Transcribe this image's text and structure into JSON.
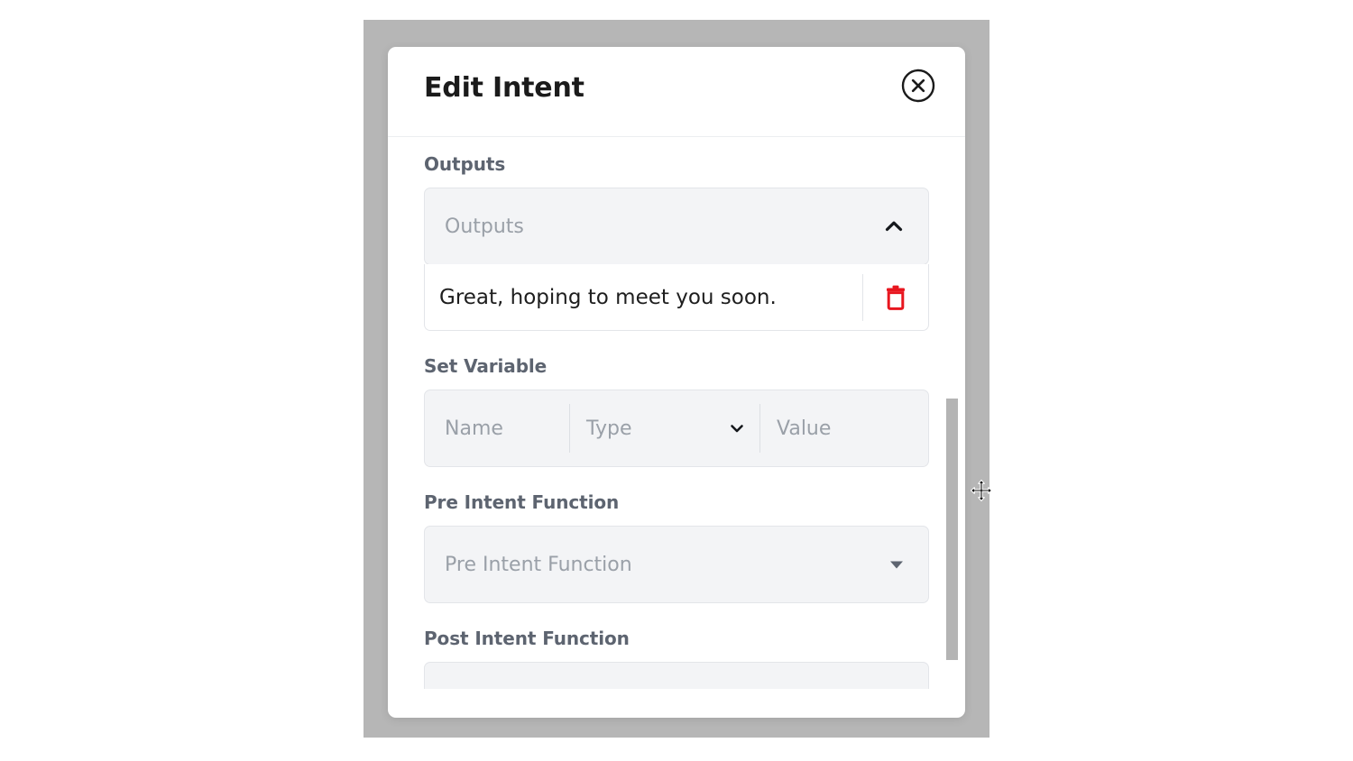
{
  "modal": {
    "title": "Edit Intent",
    "close_icon": "close-circle-icon",
    "sections": [
      {
        "label": "Outputs",
        "field_placeholder": "Outputs",
        "caret_icon": "chevron-up-icon",
        "rows": [
          {
            "text": "Great, hoping to meet you soon.",
            "delete_icon": "trash-icon"
          }
        ]
      },
      {
        "label": "Set Variable",
        "cells": {
          "name_placeholder": "Name",
          "type_placeholder": "Type",
          "type_caret_icon": "chevron-down-icon",
          "value_placeholder": "Value"
        }
      },
      {
        "label": "Pre Intent Function",
        "field_placeholder": "Pre Intent Function",
        "caret_icon": "caret-down-filled-icon"
      },
      {
        "label": "Post Intent Function",
        "field_placeholder": ""
      }
    ]
  },
  "cursor": {
    "icon": "move-cursor-icon"
  },
  "colors": {
    "backdrop": "#b6b6b6",
    "modal_bg": "#ffffff",
    "field_bg": "#f3f4f6",
    "field_border": "#e3e5e9",
    "section_label": "#5d6470",
    "placeholder": "#9aa0a8",
    "title": "#1b1b1b",
    "output_text": "#1e1e1e",
    "delete_red": "#e8161f",
    "scrollbar_thumb": "#b4b4b4"
  }
}
